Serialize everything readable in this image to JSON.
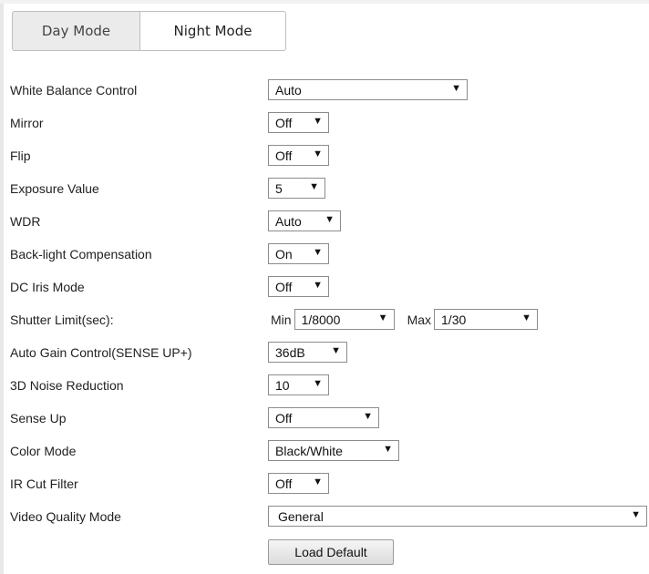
{
  "tabs": [
    {
      "label": "Day Mode",
      "active": false
    },
    {
      "label": "Night Mode",
      "active": true
    }
  ],
  "settings": {
    "white_balance": {
      "label": "White Balance Control",
      "value": "Auto"
    },
    "mirror": {
      "label": "Mirror",
      "value": "Off"
    },
    "flip": {
      "label": "Flip",
      "value": "Off"
    },
    "exposure": {
      "label": "Exposure Value",
      "value": "5"
    },
    "wdr": {
      "label": "WDR",
      "value": "Auto"
    },
    "blc": {
      "label": "Back-light Compensation",
      "value": "On"
    },
    "dc_iris": {
      "label": "DC Iris Mode",
      "value": "Off"
    },
    "shutter": {
      "label": "Shutter Limit(sec):",
      "min_label": "Min",
      "min_value": "1/8000",
      "max_label": "Max",
      "max_value": "1/30"
    },
    "agc": {
      "label": "Auto Gain Control(SENSE UP+)",
      "value": "36dB"
    },
    "noise": {
      "label": "3D Noise Reduction",
      "value": "10"
    },
    "sense_up": {
      "label": "Sense Up",
      "value": "Off"
    },
    "color_mode": {
      "label": "Color Mode",
      "value": "Black/White"
    },
    "ir_cut": {
      "label": "IR Cut Filter",
      "value": "Off"
    },
    "video_quality": {
      "label": "Video Quality Mode",
      "value": "General"
    }
  },
  "actions": {
    "load_default": "Load Default"
  },
  "icons": {
    "dropdown": "dropdown-arrow-icon",
    "glyph": "▼"
  }
}
